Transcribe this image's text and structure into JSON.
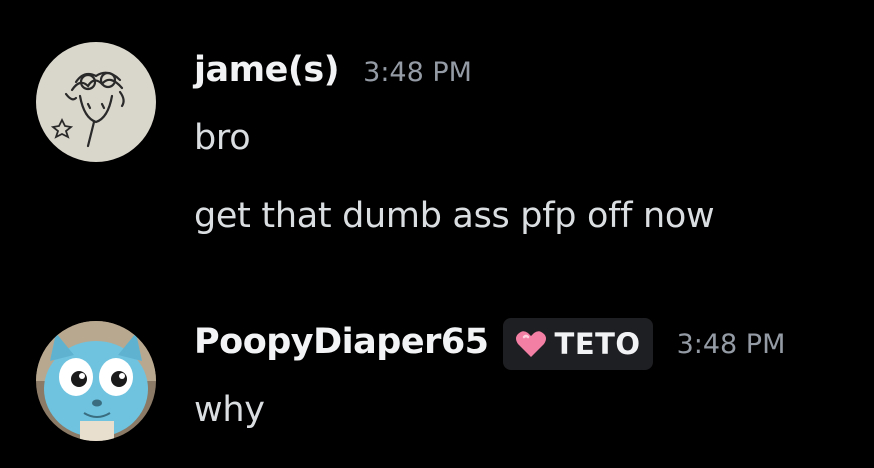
{
  "messages": [
    {
      "username": "jame(s)",
      "timestamp": "3:48 PM",
      "avatar_icon": "sketch-avatar-icon",
      "lines": [
        "bro",
        "get that dumb ass pfp off now"
      ]
    },
    {
      "username": "PoopyDiaper65",
      "timestamp": "3:48 PM",
      "avatar_icon": "blue-cat-avatar-icon",
      "tag": {
        "icon": "pink-heart-icon",
        "label": "TETO",
        "color": "#f47fa4"
      },
      "lines": [
        "why"
      ]
    }
  ],
  "colors": {
    "background": "#000000",
    "username": "#f2f3f5",
    "timestamp": "#949ba4",
    "message_text": "#dbdee1",
    "tag_background": "#1e1f22"
  }
}
